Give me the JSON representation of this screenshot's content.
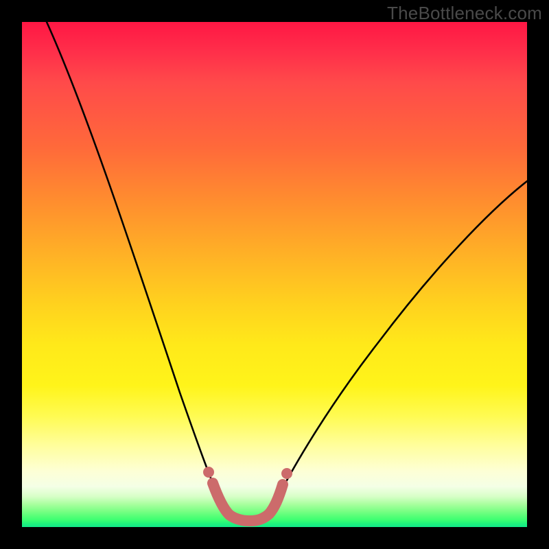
{
  "watermark": "TheBottleneck.com",
  "chart_data": {
    "type": "line",
    "title": "",
    "xlabel": "",
    "ylabel": "",
    "xlim": [
      0,
      100
    ],
    "ylim": [
      0,
      100
    ],
    "grid": false,
    "legend": false,
    "series": [
      {
        "name": "bottleneck-curve",
        "color": "#000000",
        "x": [
          5,
          8,
          11,
          14,
          17,
          20,
          23,
          26,
          29,
          32,
          34,
          36,
          37,
          38,
          39,
          40,
          41,
          42,
          43,
          44,
          45,
          46,
          47,
          48,
          49,
          50,
          52,
          55,
          59,
          63,
          68,
          74,
          80,
          86,
          92,
          98
        ],
        "y": [
          100,
          93,
          86,
          78,
          70,
          62,
          54,
          46,
          38,
          30,
          24,
          18,
          14,
          10,
          6,
          4,
          2.5,
          1.8,
          1.4,
          1.3,
          1.3,
          1.4,
          1.8,
          2.6,
          4,
          6,
          10,
          16,
          23,
          30,
          37,
          44,
          51,
          57,
          63,
          68
        ]
      },
      {
        "name": "optimal-segment",
        "color": "#cc6b6b",
        "x": [
          37,
          38.5,
          40,
          41,
          42,
          43,
          44,
          45,
          46,
          47,
          48,
          49
        ],
        "y": [
          8,
          4.5,
          2.5,
          1.8,
          1.5,
          1.4,
          1.4,
          1.5,
          1.8,
          2.6,
          4.5,
          8
        ]
      }
    ],
    "annotations": []
  }
}
